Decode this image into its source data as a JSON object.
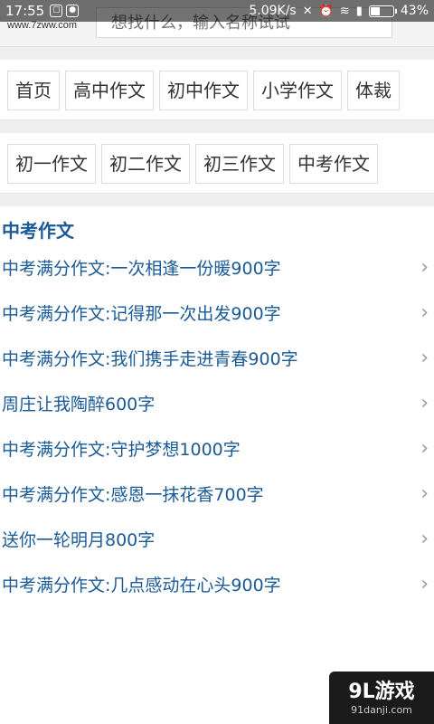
{
  "status_bar": {
    "time": "17:55",
    "speed": "5.09K/s",
    "battery": "43%",
    "battery_level": 0.43
  },
  "header": {
    "logo_text": "www.7zww.com",
    "search_placeholder": "想找什么，输入名称试试"
  },
  "nav_primary": [
    {
      "label": "首页"
    },
    {
      "label": "高中作文"
    },
    {
      "label": "初中作文"
    },
    {
      "label": "小学作文"
    },
    {
      "label": "体裁"
    }
  ],
  "nav_secondary": [
    {
      "label": "初一作文"
    },
    {
      "label": "初二作文"
    },
    {
      "label": "初三作文"
    },
    {
      "label": "中考作文"
    }
  ],
  "section": {
    "title": "中考作文",
    "items": [
      "中考满分作文:一次相逢一份暖900字",
      "中考满分作文:记得那一次出发900字",
      "中考满分作文:我们携手走进青春900字",
      "周庄让我陶醉600字",
      "中考满分作文:守护梦想1000字",
      "中考满分作文:感恩一抹花香700字",
      "送你一轮明月800字",
      "中考满分作文:几点感动在心头900字"
    ]
  },
  "watermark": {
    "main": "9L游戏",
    "sub": "91danji.com"
  }
}
